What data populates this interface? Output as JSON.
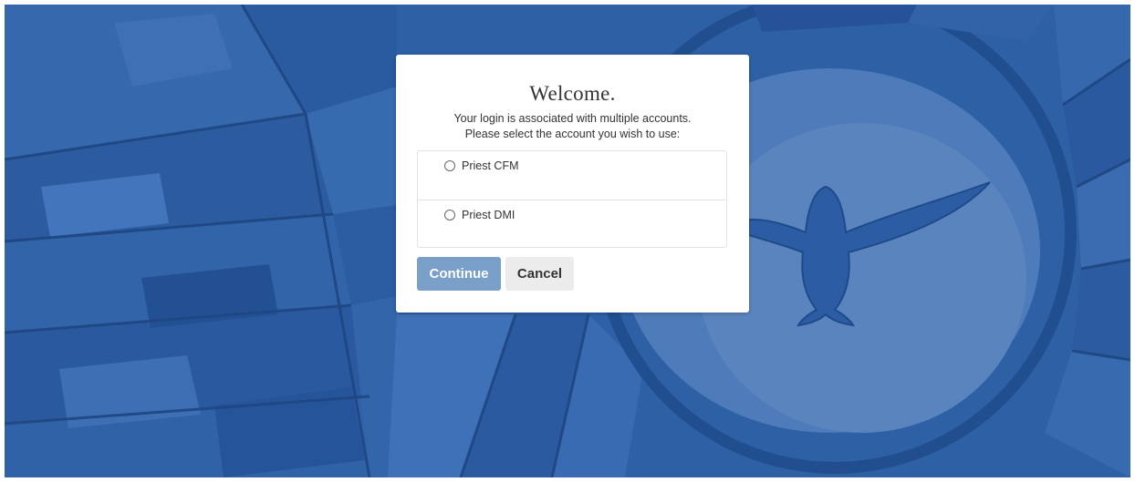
{
  "background": {
    "description_colors": {
      "base": "#2a5aa0",
      "light": "#4a7ec4",
      "dark": "#1e4a8a",
      "lead": "#1a3f78"
    }
  },
  "dialog": {
    "title": "Welcome.",
    "message_line1": "Your login is associated with multiple accounts.",
    "message_line2": "Please select the account you wish to use:",
    "accounts": [
      {
        "label": "Priest CFM",
        "selected": false
      },
      {
        "label": "Priest DMI",
        "selected": false
      }
    ],
    "continue_label": "Continue",
    "cancel_label": "Cancel",
    "continue_color": "#7aa0c9",
    "cancel_color": "#ececec"
  }
}
